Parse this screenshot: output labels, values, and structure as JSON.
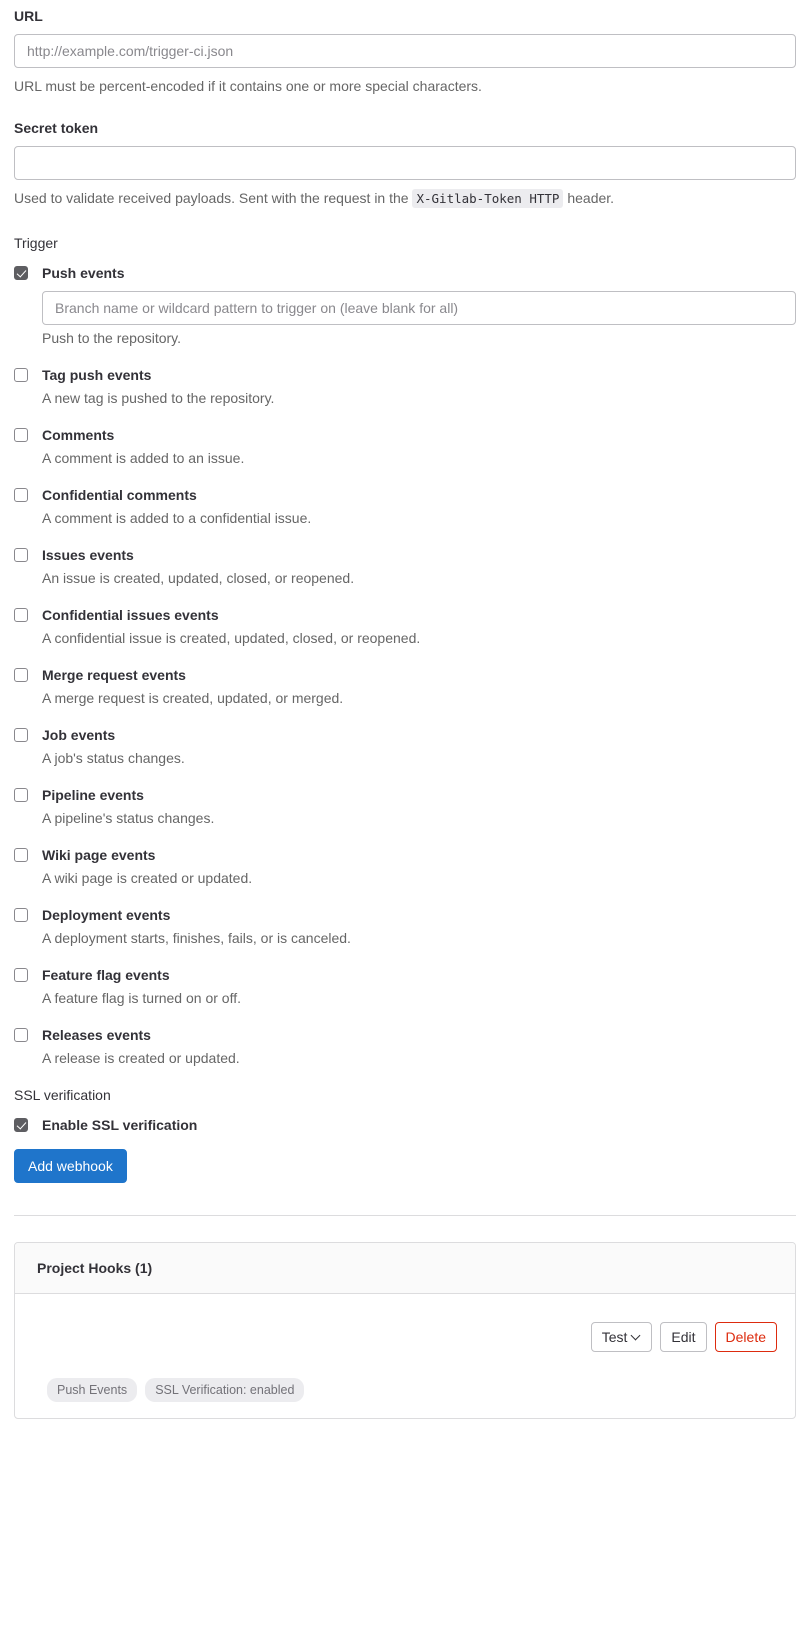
{
  "url_field": {
    "label": "URL",
    "placeholder": "http://example.com/trigger-ci.json",
    "value": "",
    "help": "URL must be percent-encoded if it contains one or more special characters."
  },
  "secret_token_field": {
    "label": "Secret token",
    "placeholder": "",
    "value": "",
    "help_before": "Used to validate received payloads. Sent with the request in the",
    "help_code": "X-Gitlab-Token HTTP",
    "help_after": "header."
  },
  "trigger": {
    "heading": "Trigger",
    "events": [
      {
        "label": "Push events",
        "description": "Push to the repository.",
        "checked": true,
        "has_branch_filter": true,
        "branch_filter_placeholder": "Branch name or wildcard pattern to trigger on (leave blank for all)",
        "branch_filter_value": ""
      },
      {
        "label": "Tag push events",
        "description": "A new tag is pushed to the repository.",
        "checked": false,
        "has_branch_filter": false
      },
      {
        "label": "Comments",
        "description": "A comment is added to an issue.",
        "checked": false,
        "has_branch_filter": false
      },
      {
        "label": "Confidential comments",
        "description": "A comment is added to a confidential issue.",
        "checked": false,
        "has_branch_filter": false
      },
      {
        "label": "Issues events",
        "description": "An issue is created, updated, closed, or reopened.",
        "checked": false,
        "has_branch_filter": false
      },
      {
        "label": "Confidential issues events",
        "description": "A confidential issue is created, updated, closed, or reopened.",
        "checked": false,
        "has_branch_filter": false
      },
      {
        "label": "Merge request events",
        "description": "A merge request is created, updated, or merged.",
        "checked": false,
        "has_branch_filter": false
      },
      {
        "label": "Job events",
        "description": "A job's status changes.",
        "checked": false,
        "has_branch_filter": false
      },
      {
        "label": "Pipeline events",
        "description": "A pipeline's status changes.",
        "checked": false,
        "has_branch_filter": false
      },
      {
        "label": "Wiki page events",
        "description": "A wiki page is created or updated.",
        "checked": false,
        "has_branch_filter": false
      },
      {
        "label": "Deployment events",
        "description": "A deployment starts, finishes, fails, or is canceled.",
        "checked": false,
        "has_branch_filter": false
      },
      {
        "label": "Feature flag events",
        "description": "A feature flag is turned on or off.",
        "checked": false,
        "has_branch_filter": false
      },
      {
        "label": "Releases events",
        "description": "A release is created or updated.",
        "checked": false,
        "has_branch_filter": false
      }
    ]
  },
  "ssl": {
    "heading": "SSL verification",
    "label": "Enable SSL verification",
    "checked": true
  },
  "submit": {
    "label": "Add webhook"
  },
  "hooks_card": {
    "title": "Project Hooks (1)",
    "actions": {
      "test_label": "Test",
      "edit_label": "Edit",
      "delete_label": "Delete"
    },
    "badges": [
      "Push Events",
      "SSL Verification: enabled"
    ]
  },
  "colors": {
    "primary": "#1f75cb",
    "danger": "#dd2b0e",
    "border": "#bfbfc3",
    "muted_text": "#666666",
    "checkbox_checked": "#5e5e62"
  }
}
